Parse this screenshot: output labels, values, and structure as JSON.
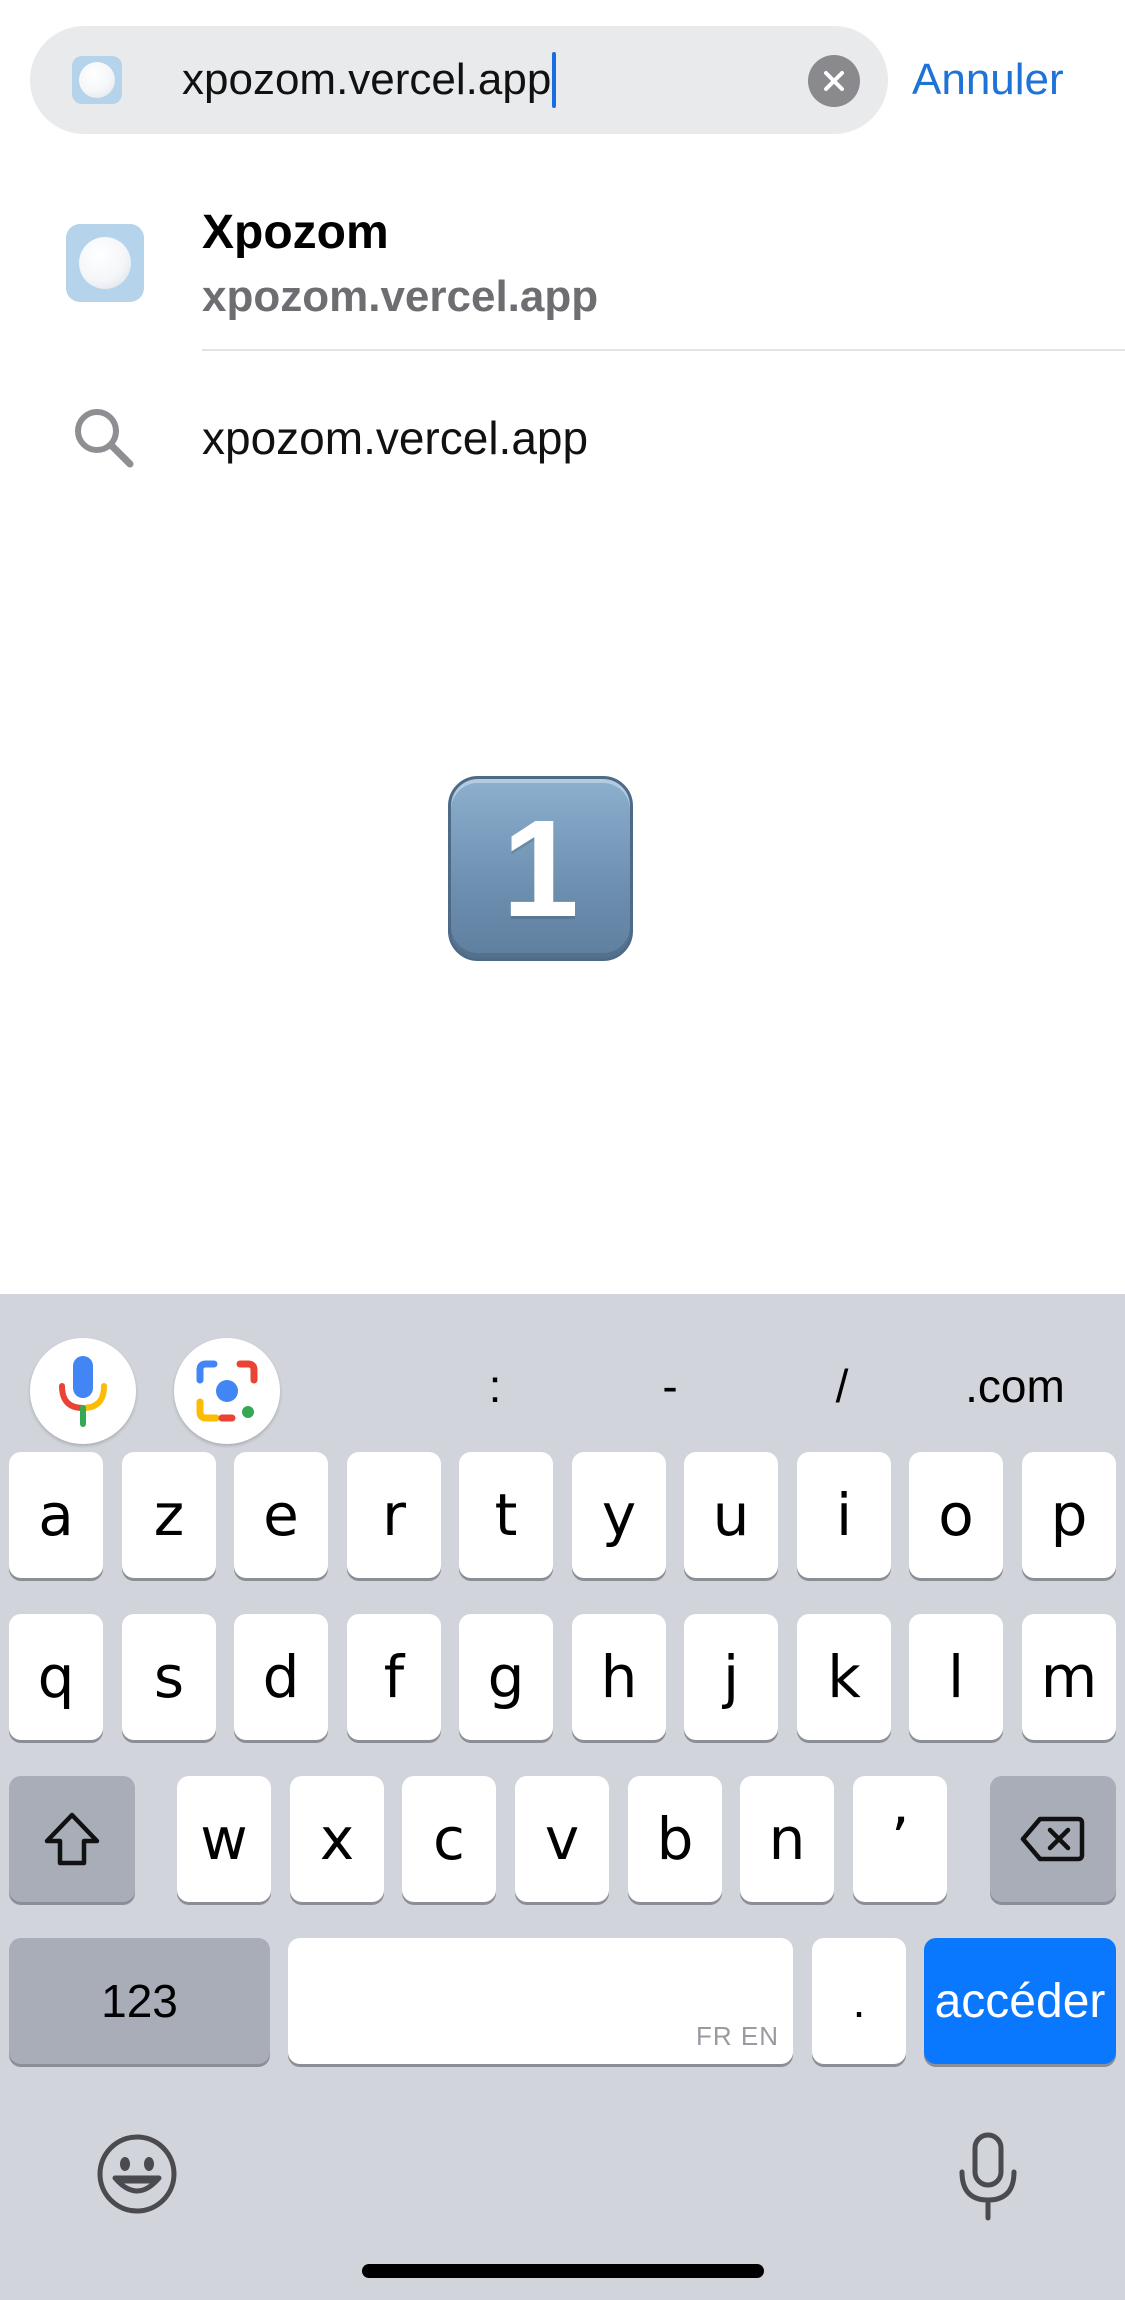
{
  "search": {
    "url_value": "xpozom.vercel.app",
    "cancel_label": "Annuler"
  },
  "suggestions": {
    "site": {
      "title": "Xpozom",
      "url": "xpozom.vercel.app"
    },
    "search_query": "xpozom.vercel.app"
  },
  "keycap": {
    "digit": "1"
  },
  "keyboard": {
    "shortcuts": [
      ":",
      "-",
      "/",
      ".com"
    ],
    "row1": [
      "a",
      "z",
      "e",
      "r",
      "t",
      "y",
      "u",
      "i",
      "o",
      "p"
    ],
    "row2": [
      "q",
      "s",
      "d",
      "f",
      "g",
      "h",
      "j",
      "k",
      "l",
      "m"
    ],
    "row3": [
      "w",
      "x",
      "c",
      "v",
      "b",
      "n",
      "’"
    ],
    "numbers_label": "123",
    "period_label": ".",
    "go_label": "accéder",
    "space_languages": "FR EN"
  },
  "colors": {
    "accent_link": "#1f72d6",
    "go_key": "#0a78fe",
    "keyboard_bg": "#d1d4db"
  }
}
